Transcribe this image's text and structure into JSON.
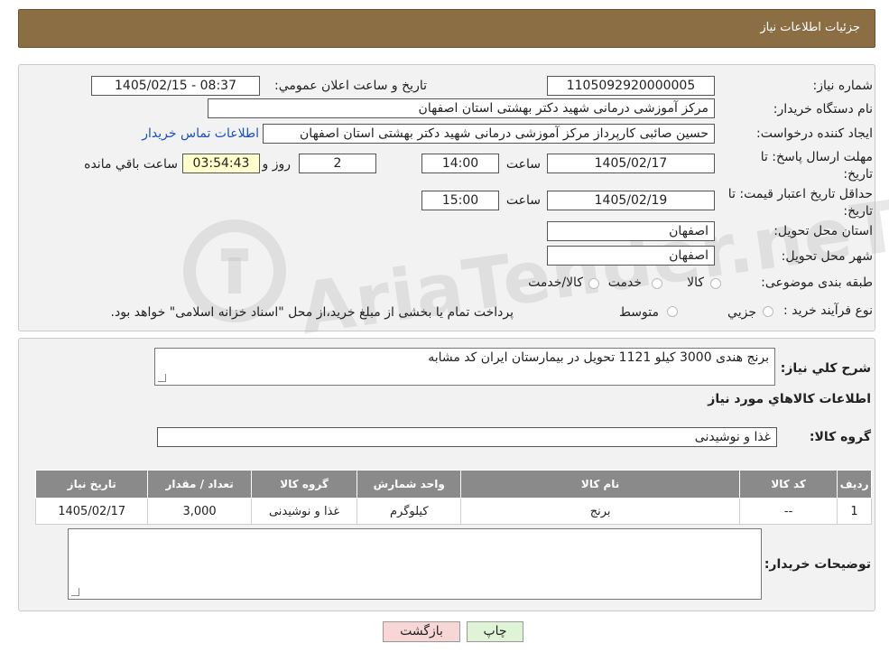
{
  "header": {
    "title": "جزئیات اطلاعات نیاز"
  },
  "fields": {
    "need_number_label": "شماره نیاز:",
    "need_number": "1105092920000005",
    "announce_label": "تاریخ و ساعت اعلان عمومي:",
    "announce_value": "1405/02/15 - 08:37",
    "buyer_org_label": "نام دستگاه خریدار:",
    "buyer_org": "مرکز آموزشی درمانی شهید دکتر بهشتی استان اصفهان",
    "requester_label": "ایجاد کننده درخواست:",
    "requester": "حسین صائبی کارپرداز  مرکز آموزشی درمانی شهید دکتر بهشتی استان اصفهان",
    "contact_link": "اطلاعات تماس خریدار",
    "reply_deadline_label": "مهلت ارسال پاسخ: تا تاریخ:",
    "reply_date": "1405/02/17",
    "time_label": "ساعت",
    "reply_time": "14:00",
    "days_value": "2",
    "days_label": "روز و",
    "remaining_time": "03:54:43",
    "remaining_label": "ساعت باقي مانده",
    "price_validity_label": "حداقل تاریخ اعتبار قیمت: تا تاریخ:",
    "validity_date": "1405/02/19",
    "validity_time": "15:00",
    "province_label": "استان محل تحویل:",
    "province": "اصفهان",
    "city_label": "شهر محل تحویل:",
    "city": "اصفهان",
    "category_label": "طبقه بندی موضوعی:",
    "category_options": [
      "کالا",
      "خدمت",
      "کالا/خدمت"
    ],
    "process_label": "نوع فرآیند خرید :",
    "process_options": [
      "جزیي",
      "متوسط"
    ],
    "process_note": "پرداخت تمام یا بخشی از مبلغ خرید،از محل \"اسناد خزانه اسلامی\" خواهد بود."
  },
  "details": {
    "description_label": "شرح کلي نياز:",
    "description": "برنج هندی 3000 کیلو 1121 تحویل در بیمارستان ایران کد مشابه",
    "goods_info_title": "اطلاعات کالاهاي مورد نياز",
    "goods_group_label": "گروه کالا:",
    "goods_group": "غذا و نوشیدنی",
    "table_headers": [
      "ردیف",
      "کد کالا",
      "نام کالا",
      "واحد شمارش",
      "گروه کالا",
      "تعداد / مقدار",
      "تاریخ نیاز"
    ],
    "table_rows": [
      [
        "1",
        "--",
        "برنج",
        "کیلوگرم",
        "غذا و نوشیدنی",
        "3,000",
        "1405/02/17"
      ]
    ],
    "buyer_notes_label": "توضیحات خریدار:",
    "buyer_notes": ""
  },
  "buttons": {
    "print": "چاپ",
    "back": "بازگشت"
  },
  "watermark": "AriaTender.neT",
  "colors": {
    "header_bg": "#8c6e44",
    "link": "#1a4fbf",
    "back_button_bg": "#f7d6d6",
    "print_button_bg": "#dff3d6",
    "table_header_bg": "#8a8a8a"
  }
}
